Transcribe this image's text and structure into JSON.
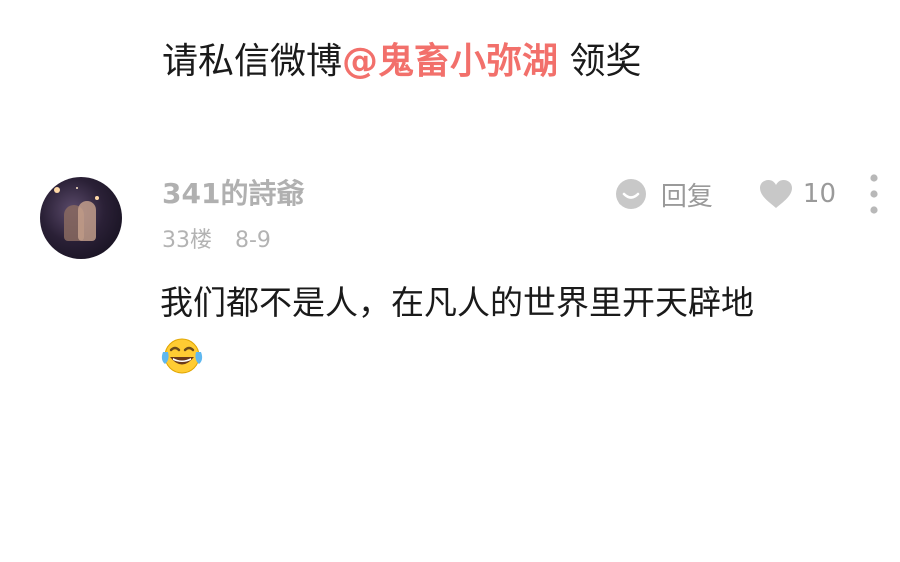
{
  "banner": {
    "prefix": "请私信微博",
    "mention": "@鬼畜小弥湖",
    "suffix": " 领奖"
  },
  "comment": {
    "username": "341的詩爺",
    "floor": "33楼",
    "date": "8-9",
    "reply_label": "回复",
    "like_count": "10",
    "text": "我们都不是人，在凡人的世界里开天辟地",
    "emoji": "tears-of-joy-emoji"
  },
  "colors": {
    "mention": "#f2706b",
    "username": "#b0b0b0",
    "meta": "#b3b3b3",
    "icon": "#c8c8c8"
  },
  "icons": {
    "reply": "comment-bubble-icon",
    "like": "heart-icon",
    "more": "more-vertical-icon"
  }
}
